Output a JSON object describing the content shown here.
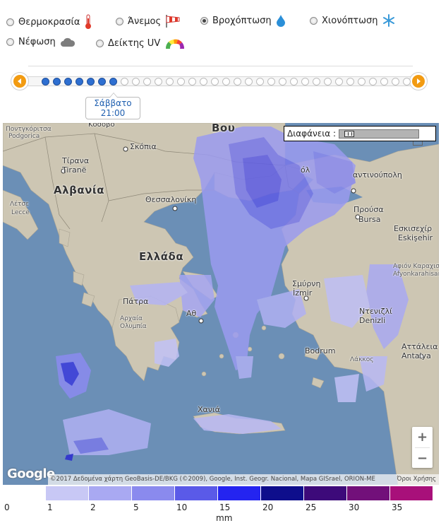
{
  "layers": {
    "temperature": {
      "label": "Θερμοκρασία",
      "checked": false,
      "icon": "thermometer-icon"
    },
    "wind": {
      "label": "Άνεμος",
      "checked": false,
      "icon": "windsock-icon"
    },
    "rain": {
      "label": "Βροχόπτωση",
      "checked": true,
      "icon": "raindrop-icon"
    },
    "snow": {
      "label": "Χιονόπτωση",
      "checked": false,
      "icon": "snowflake-icon"
    },
    "clouds": {
      "label": "Νέφωση",
      "checked": false,
      "icon": "cloud-icon"
    },
    "uv": {
      "label": "Δείκτης UV",
      "checked": false,
      "icon": "uv-gauge-icon"
    }
  },
  "timeline": {
    "total_steps": 33,
    "active_steps": 7,
    "current_day": "Σάββατο",
    "current_time": "21:00",
    "accent": "#f29b12",
    "active_color": "#2e6fd1"
  },
  "map": {
    "opacity_label": "Διαφάνεια :",
    "opacity_value": 0.05,
    "labels": {
      "kosovo": "Κόσοβο",
      "podgorica_gr": "Ποντγκόριτσα",
      "podgorica": "Podgorica",
      "skopje": "Σκόπια",
      "tirana_gr": "Τίρανα",
      "tirana": "Tiranë",
      "albania": "Αλβανία",
      "lecce_gr": "Λέτσε",
      "lecce": "Lecce",
      "thessaloniki": "Θεσσαλονίκη",
      "greece": "Ελλάδα",
      "bulgaria": "Βου",
      "edirne": "όλ",
      "istanbul": "αντινούπολη",
      "bursa_gr": "Προύσα",
      "bursa": "Bursa",
      "eskisehir_gr": "Εσκισεχίρ",
      "eskisehir": "Eskişehir",
      "afyon_gr": "Αφιόν Καραχισάρ",
      "afyon": "Afyonkarahisar",
      "izmir_gr": "Σμύρνη",
      "izmir": "İzmir",
      "patra": "Πάτρα",
      "olympia_gr": "Αρχαία",
      "olympia": "Ολυμπία",
      "athens": "Αθ",
      "denizli_gr": "Ντενιζλί",
      "denizli": "Denizli",
      "bodrum": "Bodrum",
      "antalya_gr": "Αττάλεια",
      "antalya": "Antalya",
      "chania": "Χανιά",
      "lakkos": "Λάκκος"
    },
    "attribution": "©2017 Δεδομένα χάρτη GeoBasis-DE/BKG (©2009), Google, Inst. Geogr. Nacional, Mapa GISrael, ORION-ME",
    "terms": "Όροι Χρήσης",
    "google": "Google",
    "zoom_in": "+",
    "zoom_out": "−",
    "colors": {
      "sea": "#6b8fb6",
      "land": "#cdc6b3",
      "rain": "#8f8ff0"
    }
  },
  "legend": {
    "unit": "mm",
    "steps": [
      {
        "label": "0",
        "color": "#ffffff"
      },
      {
        "label": "1",
        "color": "#c8c8f5"
      },
      {
        "label": "2",
        "color": "#a9a9f2"
      },
      {
        "label": "5",
        "color": "#8a8aee"
      },
      {
        "label": "10",
        "color": "#5a5ae8"
      },
      {
        "label": "15",
        "color": "#2424f0"
      },
      {
        "label": "20",
        "color": "#0e0e8c"
      },
      {
        "label": "25",
        "color": "#3d0a7a"
      },
      {
        "label": "30",
        "color": "#72107a"
      },
      {
        "label": "35",
        "color": "#a8107a"
      }
    ]
  }
}
